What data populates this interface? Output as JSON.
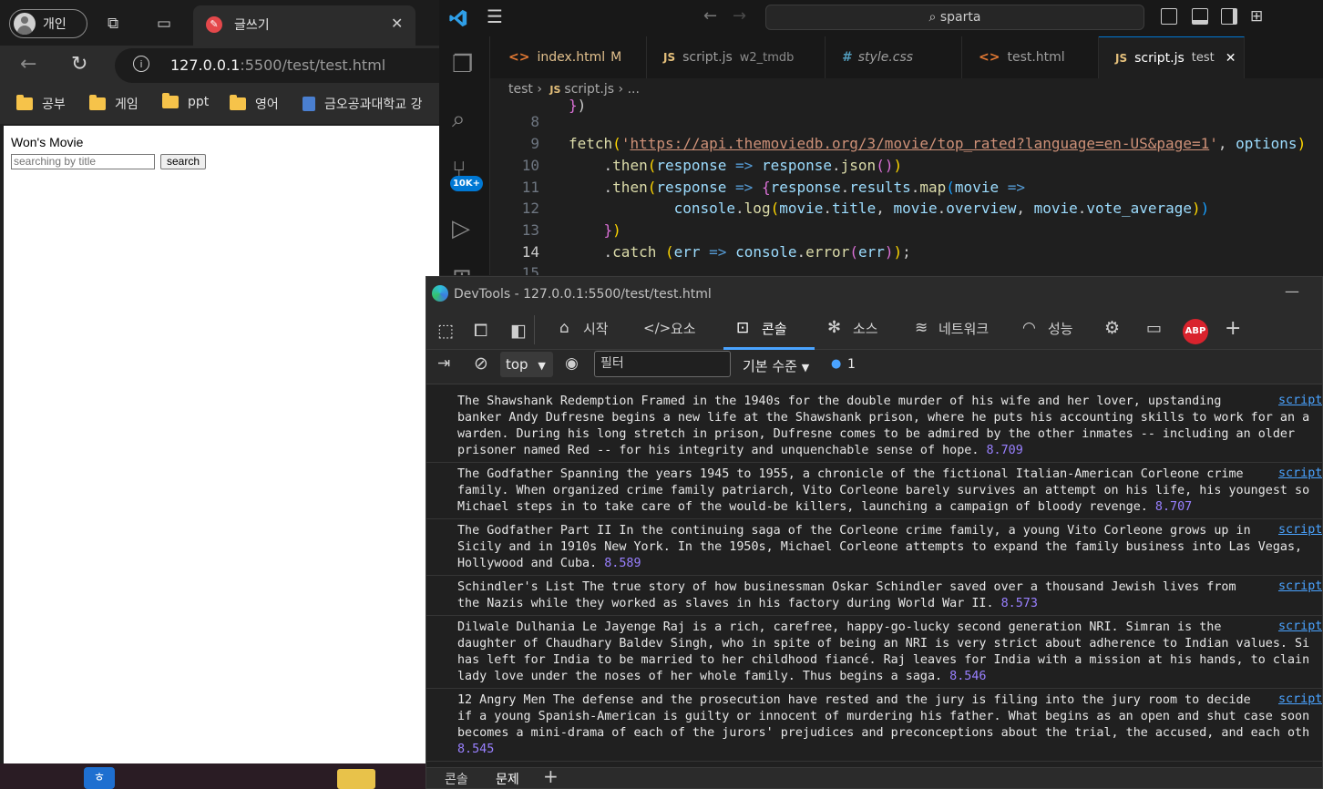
{
  "browser": {
    "profile_label": "개인",
    "tab_title": "글쓰기",
    "url_host": "127.0.0.1",
    "url_rest": ":5500/test/test.html",
    "bookmarks": [
      "공부",
      "게임",
      "ppt",
      "영어",
      "금오공과대학교 강"
    ],
    "page": {
      "title": "Won's Movie",
      "search_placeholder": "searching by title",
      "search_button": "search"
    }
  },
  "vscode": {
    "search": "sparta",
    "tabs": [
      {
        "label": "index.html",
        "flag": "M"
      },
      {
        "label": "script.js",
        "detail": "w2_tmdb"
      },
      {
        "label": "style.css"
      },
      {
        "label": "test.html"
      },
      {
        "label": "script.js",
        "detail": "test"
      }
    ],
    "breadcrumb": [
      "test",
      "script.js",
      "..."
    ],
    "badge": "10K+",
    "line_numbers": [
      "8",
      "9",
      "10",
      "11",
      "12",
      "13",
      "14",
      "15"
    ],
    "current_line": "14",
    "code": {
      "fetch_url": "https://api.themoviedb.org/3/movie/top_rated?language=en-US&page=1"
    }
  },
  "devtools": {
    "title": "DevTools - 127.0.0.1:5500/test/test.html",
    "tabs": [
      "시작",
      "요소",
      "콘솔",
      "소스",
      "네트워크",
      "성능"
    ],
    "active_tab": "콘솔",
    "context": "top",
    "filter_placeholder": "필터",
    "level": "기본 수준",
    "message_count": "1",
    "source_link": "script",
    "entries": [
      {
        "lines": [
          "The Shawshank Redemption Framed in the 1940s for the double murder of his wife and her lover, upstanding",
          "banker Andy Dufresne begins a new life at the Shawshank prison, where he puts his accounting skills to work for an a",
          "warden. During his long stretch in prison, Dufresne comes to be admired by the other inmates -- including an older",
          "prisoner named Red -- for his integrity and unquenchable sense of hope. "
        ],
        "rating": "8.709"
      },
      {
        "lines": [
          "The Godfather Spanning the years 1945 to 1955, a chronicle of the fictional Italian-American Corleone crime",
          "family. When organized crime family patriarch, Vito Corleone barely survives an attempt on his life, his youngest so",
          "Michael steps in to take care of the would-be killers, launching a campaign of bloody revenge. "
        ],
        "rating": "8.707"
      },
      {
        "lines": [
          "The Godfather Part II In the continuing saga of the Corleone crime family, a young Vito Corleone grows up in",
          "Sicily and in 1910s New York. In the 1950s, Michael Corleone attempts to expand the family business into Las Vegas,",
          "Hollywood and Cuba. "
        ],
        "rating": "8.589"
      },
      {
        "lines": [
          "Schindler's List The true story of how businessman Oskar Schindler saved over a thousand Jewish lives from",
          "the Nazis while they worked as slaves in his factory during World War II. "
        ],
        "rating": "8.573"
      },
      {
        "lines": [
          "Dilwale Dulhania Le Jayenge Raj is a rich, carefree, happy-go-lucky second generation NRI. Simran is the",
          "daughter of Chaudhary Baldev Singh, who in spite of being an NRI is very strict about adherence to Indian values. Si",
          "has left for India to be married to her childhood fiancé. Raj leaves for India with a mission at his hands, to clain",
          "lady love under the noses of her whole family. Thus begins a saga. "
        ],
        "rating": "8.546"
      },
      {
        "lines": [
          "12 Angry Men The defense and the prosecution have rested and the jury is filing into the jury room to decide",
          "if a young Spanish-American is guilty or innocent of murdering his father. What begins as an open and shut case soon",
          "becomes a mini-drama of each of the jurors' prejudices and preconceptions about the trial, the accused, and each oth",
          ""
        ],
        "rating": "8.545"
      }
    ],
    "bottom_tabs": [
      "콘솔",
      "문제"
    ]
  }
}
